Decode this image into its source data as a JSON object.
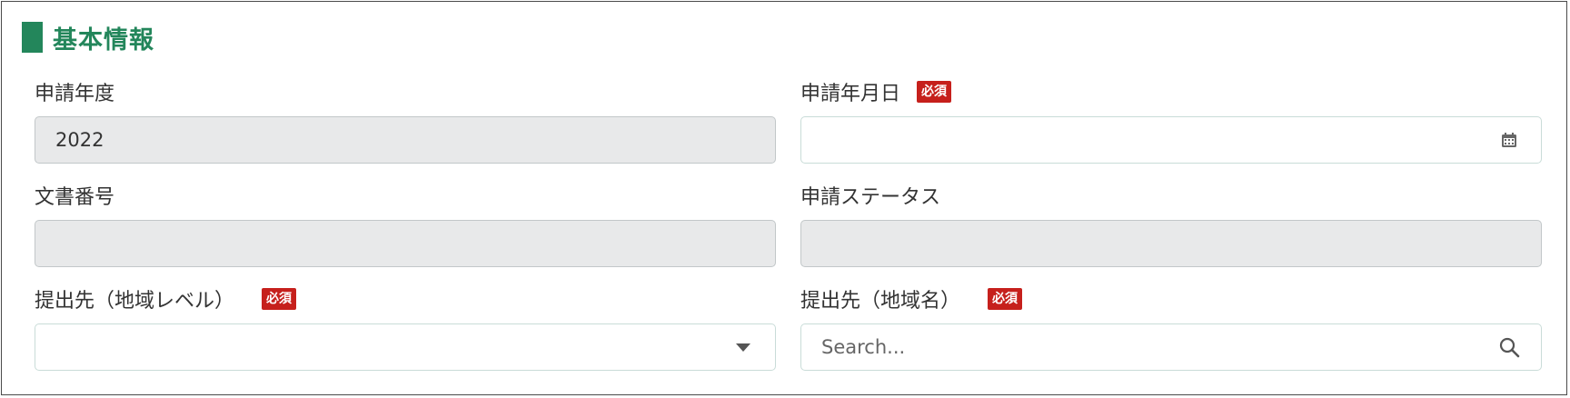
{
  "section": {
    "title": "基本情報"
  },
  "fields": {
    "fiscal_year": {
      "label": "申請年度",
      "value": "2022"
    },
    "application_date": {
      "label": "申請年月日",
      "required": "必須",
      "value": ""
    },
    "document_number": {
      "label": "文書番号",
      "value": ""
    },
    "application_status": {
      "label": "申請ステータス",
      "value": ""
    },
    "destination_level": {
      "label": "提出先（地域レベル）",
      "required": "必須",
      "value": ""
    },
    "destination_name": {
      "label": "提出先（地域名）",
      "required": "必須",
      "placeholder": "Search..."
    }
  },
  "icons": {
    "date_picker": "calendar-icon",
    "dropdown": "caret-down-icon",
    "search": "search-icon"
  },
  "colors": {
    "accent": "#23865b",
    "required_badge": "#c6201c",
    "disabled_bg": "#e8e9ea"
  }
}
